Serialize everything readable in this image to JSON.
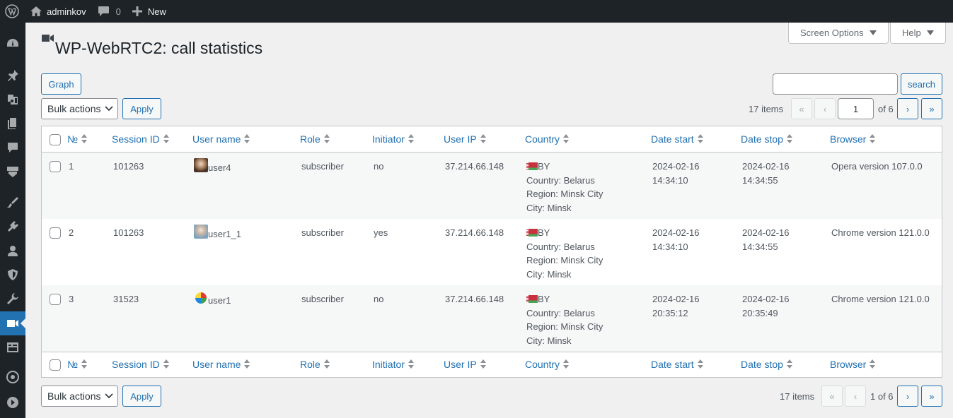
{
  "adminbar": {
    "username": "adminkov",
    "comments_count": "0",
    "new_label": "New"
  },
  "page": {
    "title": "WP-WebRTC2: call statistics"
  },
  "screen_options": {
    "label": "Screen Options",
    "help_label": "Help"
  },
  "toolbar": {
    "graph_label": "Graph",
    "search_value": "",
    "search_label": "search",
    "bulk_actions": "Bulk actions",
    "apply_label": "Apply",
    "items_count": "17 items",
    "first": "«",
    "prev": "‹",
    "next": "›",
    "last": "»",
    "current_page": "1",
    "total_pages": "of 6",
    "page_of": "1 of 6"
  },
  "table": {
    "columns": [
      "№",
      "Session ID",
      "User name",
      "Role",
      "Initiator",
      "User IP",
      "Country",
      "Date start",
      "Date stop",
      "Browser"
    ],
    "rows": [
      {
        "num": "1",
        "session": "101263",
        "user": "user4",
        "role": "subscriber",
        "initiator": "no",
        "ip": "37.214.66.148",
        "country_code": "BY",
        "country": "Country: Belarus",
        "region": "Region: Minsk City",
        "city": "City: Minsk",
        "date_start_d": "2024-02-16",
        "date_start_t": "14:34:10",
        "date_stop_d": "2024-02-16",
        "date_stop_t": "14:34:55",
        "browser": "Opera version 107.0.0"
      },
      {
        "num": "2",
        "session": "101263",
        "user": "user1_1",
        "role": "subscriber",
        "initiator": "yes",
        "ip": "37.214.66.148",
        "country_code": "BY",
        "country": "Country: Belarus",
        "region": "Region: Minsk City",
        "city": "City: Minsk",
        "date_start_d": "2024-02-16",
        "date_start_t": "14:34:10",
        "date_stop_d": "2024-02-16",
        "date_stop_t": "14:34:55",
        "browser": "Chrome version 121.0.0"
      },
      {
        "num": "3",
        "session": "31523",
        "user": "user1",
        "role": "subscriber",
        "initiator": "no",
        "ip": "37.214.66.148",
        "country_code": "BY",
        "country": "Country: Belarus",
        "region": "Region: Minsk City",
        "city": "City: Minsk",
        "date_start_d": "2024-02-16",
        "date_start_t": "20:35:12",
        "date_stop_d": "2024-02-16",
        "date_stop_t": "20:35:49",
        "browser": "Chrome version 121.0.0"
      }
    ]
  },
  "colors": {
    "accent": "#2271b1",
    "adminbar": "#1d2327"
  }
}
